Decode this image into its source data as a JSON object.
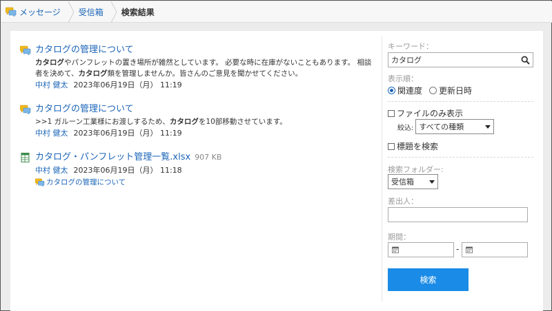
{
  "breadcrumb": {
    "items": [
      "メッセージ",
      "受信箱",
      "検索結果"
    ]
  },
  "results": [
    {
      "title": "カタログの管理について",
      "snippet_html": "<b>カタログ</b>やパンフレットの置き場所が雑然としています。 必要な時に在庫がないこともあります。 相談者を決めて、<b>カタログ</b>類を管理しませんか。皆さんのご意見を聞かせてください。",
      "author": "中村 健太",
      "date": "2023年06月19日（月） 11:19"
    },
    {
      "title": "カタログの管理について",
      "snippet_html": ">>1 ガルーン工業様にお渡しするため、<b>カタログ</b>を10部移動させています。",
      "author": "中村 健太",
      "date": "2023年06月19日（月） 11:19"
    },
    {
      "title": "カタログ・パンフレット管理一覧.xlsx",
      "size": "907 KB",
      "author": "中村 健太",
      "date": "2023年06月19日（月） 11:18",
      "link": "カタログの管理について"
    }
  ],
  "sidebar": {
    "keyword_label": "キーワード：",
    "keyword_value": "カタログ",
    "order_label": "表示順：",
    "order_relevance": "関連度",
    "order_updated": "更新日時",
    "files_only": "ファイルのみ表示",
    "narrow_label": "絞込:",
    "narrow_value": "すべての種類",
    "search_titles": "標題を検索",
    "folder_label": "検索フォルダー:",
    "folder_value": "受信箱",
    "sender_label": "差出人：",
    "period_label": "期間：",
    "period_dash": "-",
    "search_button": "検索"
  },
  "colors": {
    "link": "#1a64b8",
    "button": "#1a8be6"
  }
}
